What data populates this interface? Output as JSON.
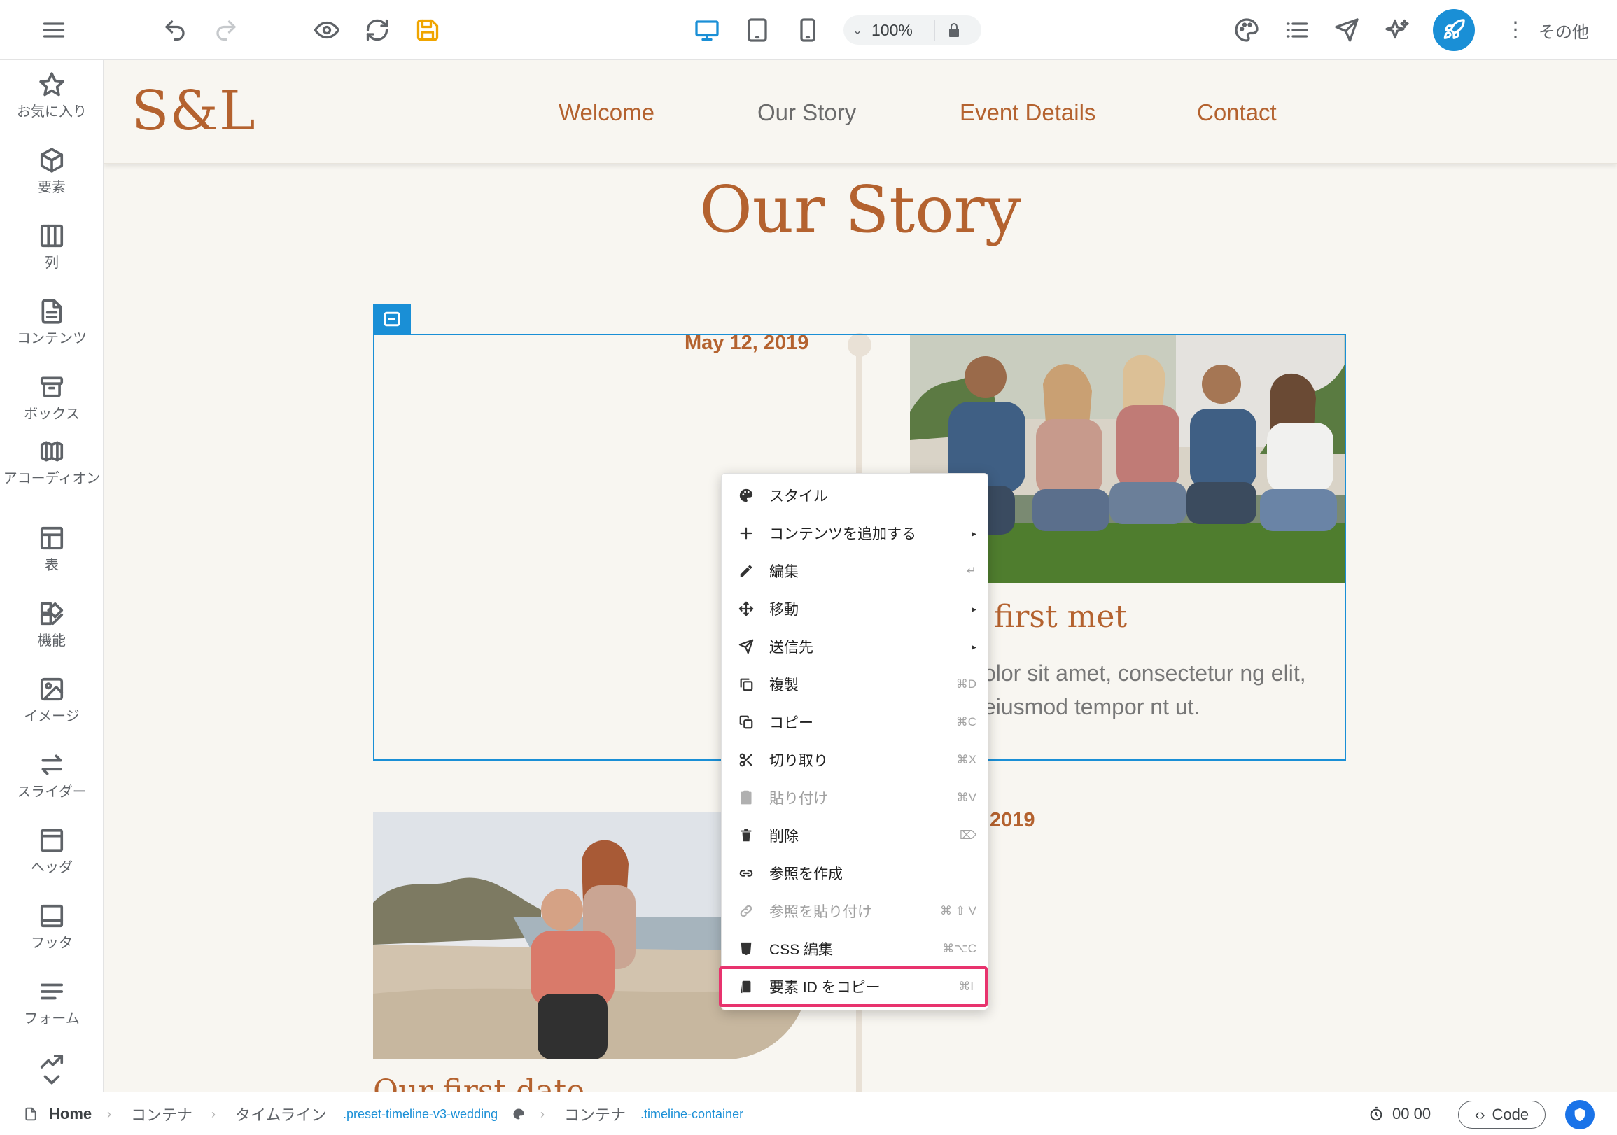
{
  "toolbar": {
    "zoom": "100%",
    "more_label": "その他",
    "icons": [
      "menu-icon",
      "undo-icon",
      "redo-icon",
      "preview-icon",
      "refresh-icon",
      "save-icon",
      "desktop-icon",
      "tablet-icon",
      "mobile-icon",
      "lock-icon",
      "palette-icon",
      "list-icon",
      "send-icon",
      "ai-sparkle-icon",
      "publish-rocket-icon",
      "more-vert-icon"
    ],
    "accent_color": "#1a8fd6",
    "save_color": "#f0a500"
  },
  "sidebar": {
    "items": [
      {
        "label": "お気に入り",
        "icon": "star-icon"
      },
      {
        "label": "要素",
        "icon": "cube-icon"
      },
      {
        "label": "列",
        "icon": "columns-icon"
      },
      {
        "label": "コンテンツ",
        "icon": "document-icon"
      },
      {
        "label": "ボックス",
        "icon": "box-icon"
      },
      {
        "label": "アコーディオン",
        "icon": "accordion-icon"
      },
      {
        "label": "表",
        "icon": "table-icon"
      },
      {
        "label": "機能",
        "icon": "features-icon"
      },
      {
        "label": "イメージ",
        "icon": "image-icon"
      },
      {
        "label": "スライダー",
        "icon": "slider-icon"
      },
      {
        "label": "ヘッダ",
        "icon": "header-icon"
      },
      {
        "label": "フッタ",
        "icon": "footer-icon"
      },
      {
        "label": "フォーム",
        "icon": "form-icon"
      }
    ]
  },
  "site": {
    "logo": "S&L",
    "nav": [
      "Welcome",
      "Our Story",
      "Event Details",
      "Contact"
    ],
    "page_title": "Our Story",
    "brand_color": "#b4622f",
    "timeline": {
      "date1": "May 12, 2019",
      "entry1_title": "n we first met",
      "entry1_body": "psum dolor sit amet, consectetur ng elit, sed do eiusmod tempor nt ut.",
      "date2": "2019",
      "entry2_title": "Our first date"
    }
  },
  "context_menu": {
    "items": [
      {
        "label": "スタイル",
        "shortcut": "",
        "icon": "palette-icon"
      },
      {
        "label": "コンテンツを追加する",
        "shortcut": "",
        "icon": "plus-icon",
        "submenu": true
      },
      {
        "label": "編集",
        "shortcut": "↵",
        "icon": "pencil-icon"
      },
      {
        "label": "移動",
        "shortcut": "",
        "icon": "move-icon",
        "submenu": true
      },
      {
        "label": "送信先",
        "shortcut": "",
        "icon": "send-icon",
        "submenu": true
      },
      {
        "label": "複製",
        "shortcut": "⌘D",
        "icon": "duplicate-icon"
      },
      {
        "label": "コピー",
        "shortcut": "⌘C",
        "icon": "copy-icon"
      },
      {
        "label": "切り取り",
        "shortcut": "⌘X",
        "icon": "scissors-icon"
      },
      {
        "label": "貼り付け",
        "shortcut": "⌘V",
        "icon": "paste-icon",
        "disabled": true
      },
      {
        "label": "削除",
        "shortcut": "⌦",
        "icon": "trash-icon"
      },
      {
        "label": "参照を作成",
        "shortcut": "",
        "icon": "link-icon"
      },
      {
        "label": "参照を貼り付け",
        "shortcut": "⌘ ⇧ V",
        "icon": "link-paste-icon",
        "disabled": true
      },
      {
        "label": "CSS 編集",
        "shortcut": "⌘⌥C",
        "icon": "css-icon"
      },
      {
        "label": "要素 ID をコピー",
        "shortcut": "⌘I",
        "icon": "clipboard-id-icon",
        "highlighted": true
      }
    ],
    "highlight_color": "#e8336e"
  },
  "breadcrumb": {
    "home": "Home",
    "items": [
      "コンテナ",
      "タイムライン",
      ".preset-timeline-v3-wedding",
      "コンテナ",
      ".timeline-container"
    ]
  },
  "statusbar": {
    "timer": "00 00",
    "code_label": "Code"
  }
}
